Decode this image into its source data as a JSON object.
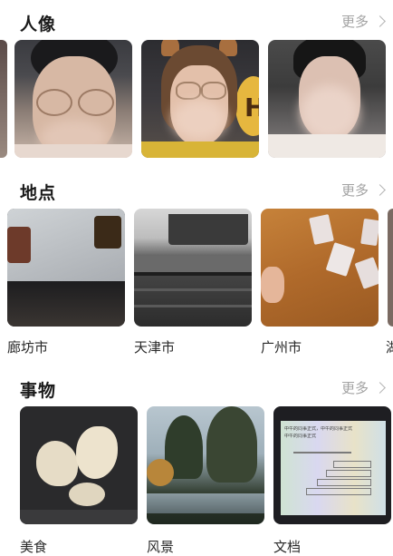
{
  "sections": {
    "people": {
      "title": "人像",
      "more": "更多"
    },
    "places": {
      "title": "地点",
      "more": "更多",
      "items": [
        {
          "label": "廊坊市"
        },
        {
          "label": "天津市"
        },
        {
          "label": "广州市"
        },
        {
          "label": "湖"
        }
      ]
    },
    "things": {
      "title": "事物",
      "more": "更多",
      "items": [
        {
          "label": "美食"
        },
        {
          "label": "风景"
        },
        {
          "label": "文档"
        }
      ]
    }
  },
  "document_slide": {
    "line1": "中午的同事正式，中午的同事正式",
    "line2": "中午的同事正式"
  }
}
